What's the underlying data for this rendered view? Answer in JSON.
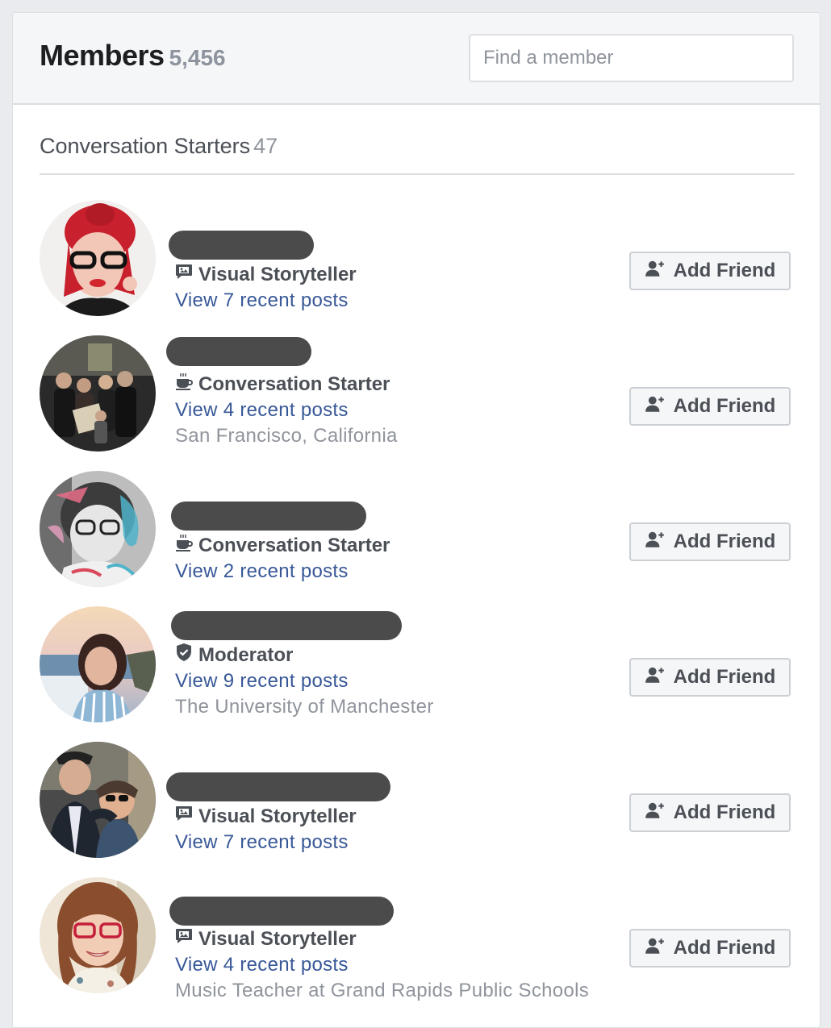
{
  "header": {
    "title": "Members",
    "count": "5,456",
    "search_placeholder": "Find a member"
  },
  "section": {
    "title": "Conversation Starters",
    "count": "47"
  },
  "members": [
    {
      "badge": "Visual Storyteller",
      "badge_icon": "photo-chat-icon",
      "posts": "View 7 recent posts",
      "subtext": "",
      "button": "Add Friend"
    },
    {
      "badge": "Conversation Starter",
      "badge_icon": "coffee-cup-icon",
      "posts": "View 4 recent posts",
      "subtext": "San Francisco, California",
      "button": "Add Friend"
    },
    {
      "badge": "Conversation Starter",
      "badge_icon": "coffee-cup-icon",
      "posts": "View 2 recent posts",
      "subtext": "",
      "button": "Add Friend"
    },
    {
      "badge": "Moderator",
      "badge_icon": "shield-check-icon",
      "posts": "View 9 recent posts",
      "subtext": "The University of Manchester",
      "button": "Add Friend"
    },
    {
      "badge": "Visual Storyteller",
      "badge_icon": "photo-chat-icon",
      "posts": "View 7 recent posts",
      "subtext": "",
      "button": "Add Friend"
    },
    {
      "badge": "Visual Storyteller",
      "badge_icon": "photo-chat-icon",
      "posts": "View 4 recent posts",
      "subtext": "Music Teacher at Grand Rapids Public Schools",
      "button": "Add Friend"
    }
  ],
  "colors": {
    "link": "#385898",
    "muted": "#90949c",
    "redacted_bar": "#4b4b4b"
  }
}
